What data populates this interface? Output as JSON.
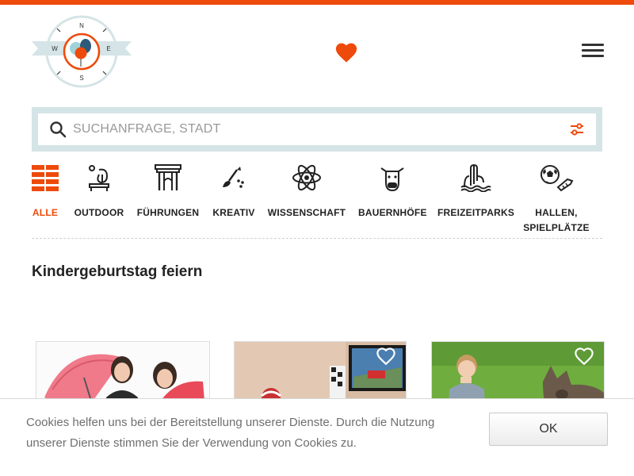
{
  "header": {
    "logo_letters": {
      "n": "N",
      "e": "E",
      "s": "S",
      "w": "W"
    }
  },
  "search": {
    "placeholder": "SUCHANFRAGE, STADT",
    "value": ""
  },
  "categories": [
    {
      "label": "ALLE",
      "icon": "grid-icon",
      "active": true
    },
    {
      "label": "OUTDOOR",
      "icon": "outdoor-icon"
    },
    {
      "label": "FÜHRUNGEN",
      "icon": "gate-icon"
    },
    {
      "label": "KREATIV",
      "icon": "paintbrush-icon"
    },
    {
      "label": "WISSENSCHAFT",
      "icon": "atom-icon"
    },
    {
      "label": "BAUERNHÖFE",
      "icon": "cow-icon"
    },
    {
      "label": "FREIZEITPARKS",
      "icon": "waterslide-icon"
    },
    {
      "label": "HALLEN,",
      "label2": "SPIELPLÄTZE",
      "icon": "ball-icon"
    }
  ],
  "section": {
    "title": "Kindergeburtstag feiern"
  },
  "cookie": {
    "text": "Cookies helfen uns bei der Bereitstellung unserer Dienste. Durch die Nutzung unserer Dienste stimmen Sie der Verwendung von Cookies zu.",
    "button": "OK"
  },
  "colors": {
    "accent": "#ee4a0b",
    "search_frame": "#d5e4e6"
  }
}
